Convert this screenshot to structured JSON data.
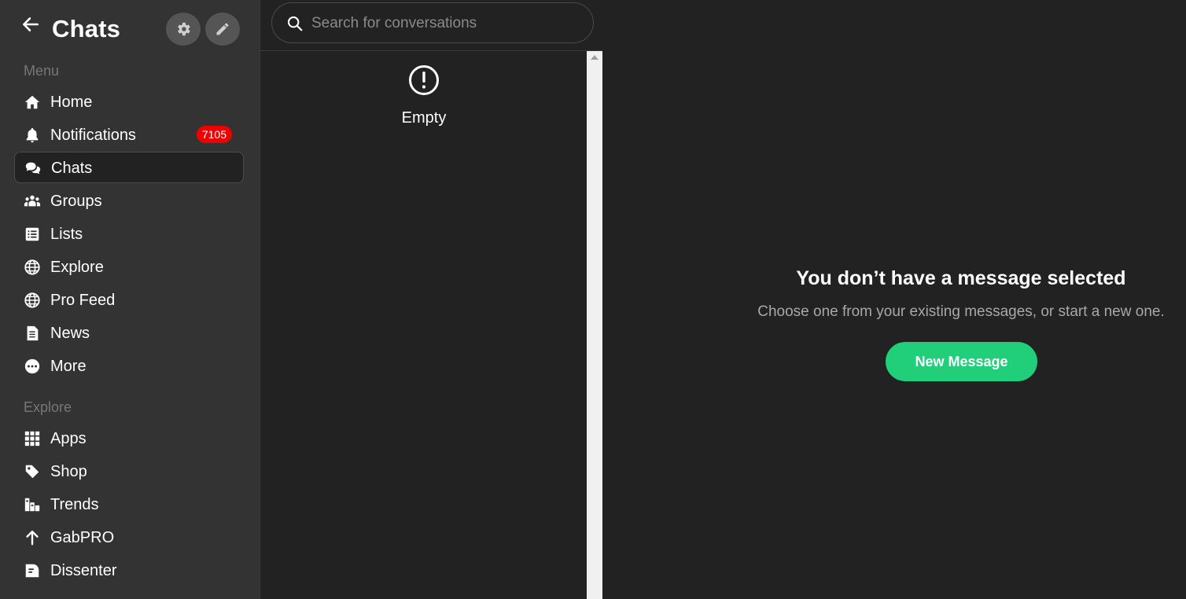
{
  "header": {
    "title": "Chats"
  },
  "sidebar": {
    "menu_label": "Menu",
    "menu_items": [
      {
        "label": "Home",
        "icon": "home-icon"
      },
      {
        "label": "Notifications",
        "icon": "bell-icon",
        "badge": "7105"
      },
      {
        "label": "Chats",
        "icon": "chat-icon",
        "active": true
      },
      {
        "label": "Groups",
        "icon": "groups-icon"
      },
      {
        "label": "Lists",
        "icon": "list-icon"
      },
      {
        "label": "Explore",
        "icon": "globe-icon"
      },
      {
        "label": "Pro Feed",
        "icon": "globe-icon"
      },
      {
        "label": "News",
        "icon": "document-icon"
      },
      {
        "label": "More",
        "icon": "more-icon"
      }
    ],
    "explore_label": "Explore",
    "explore_items": [
      {
        "label": "Apps",
        "icon": "grid-icon"
      },
      {
        "label": "Shop",
        "icon": "tag-icon"
      },
      {
        "label": "Trends",
        "icon": "trends-icon"
      },
      {
        "label": "GabPRO",
        "icon": "arrow-up-icon"
      },
      {
        "label": "Dissenter",
        "icon": "dissenter-icon"
      }
    ]
  },
  "conversations": {
    "search_placeholder": "Search for conversations",
    "empty_label": "Empty"
  },
  "main": {
    "title": "You don’t have a message selected",
    "subtitle": "Choose one from your existing messages, or start a new one.",
    "new_message_label": "New Message"
  },
  "colors": {
    "sidebar_bg": "#333333",
    "content_bg": "#222222",
    "accent": "#21cf7a",
    "badge": "#ee0000"
  }
}
